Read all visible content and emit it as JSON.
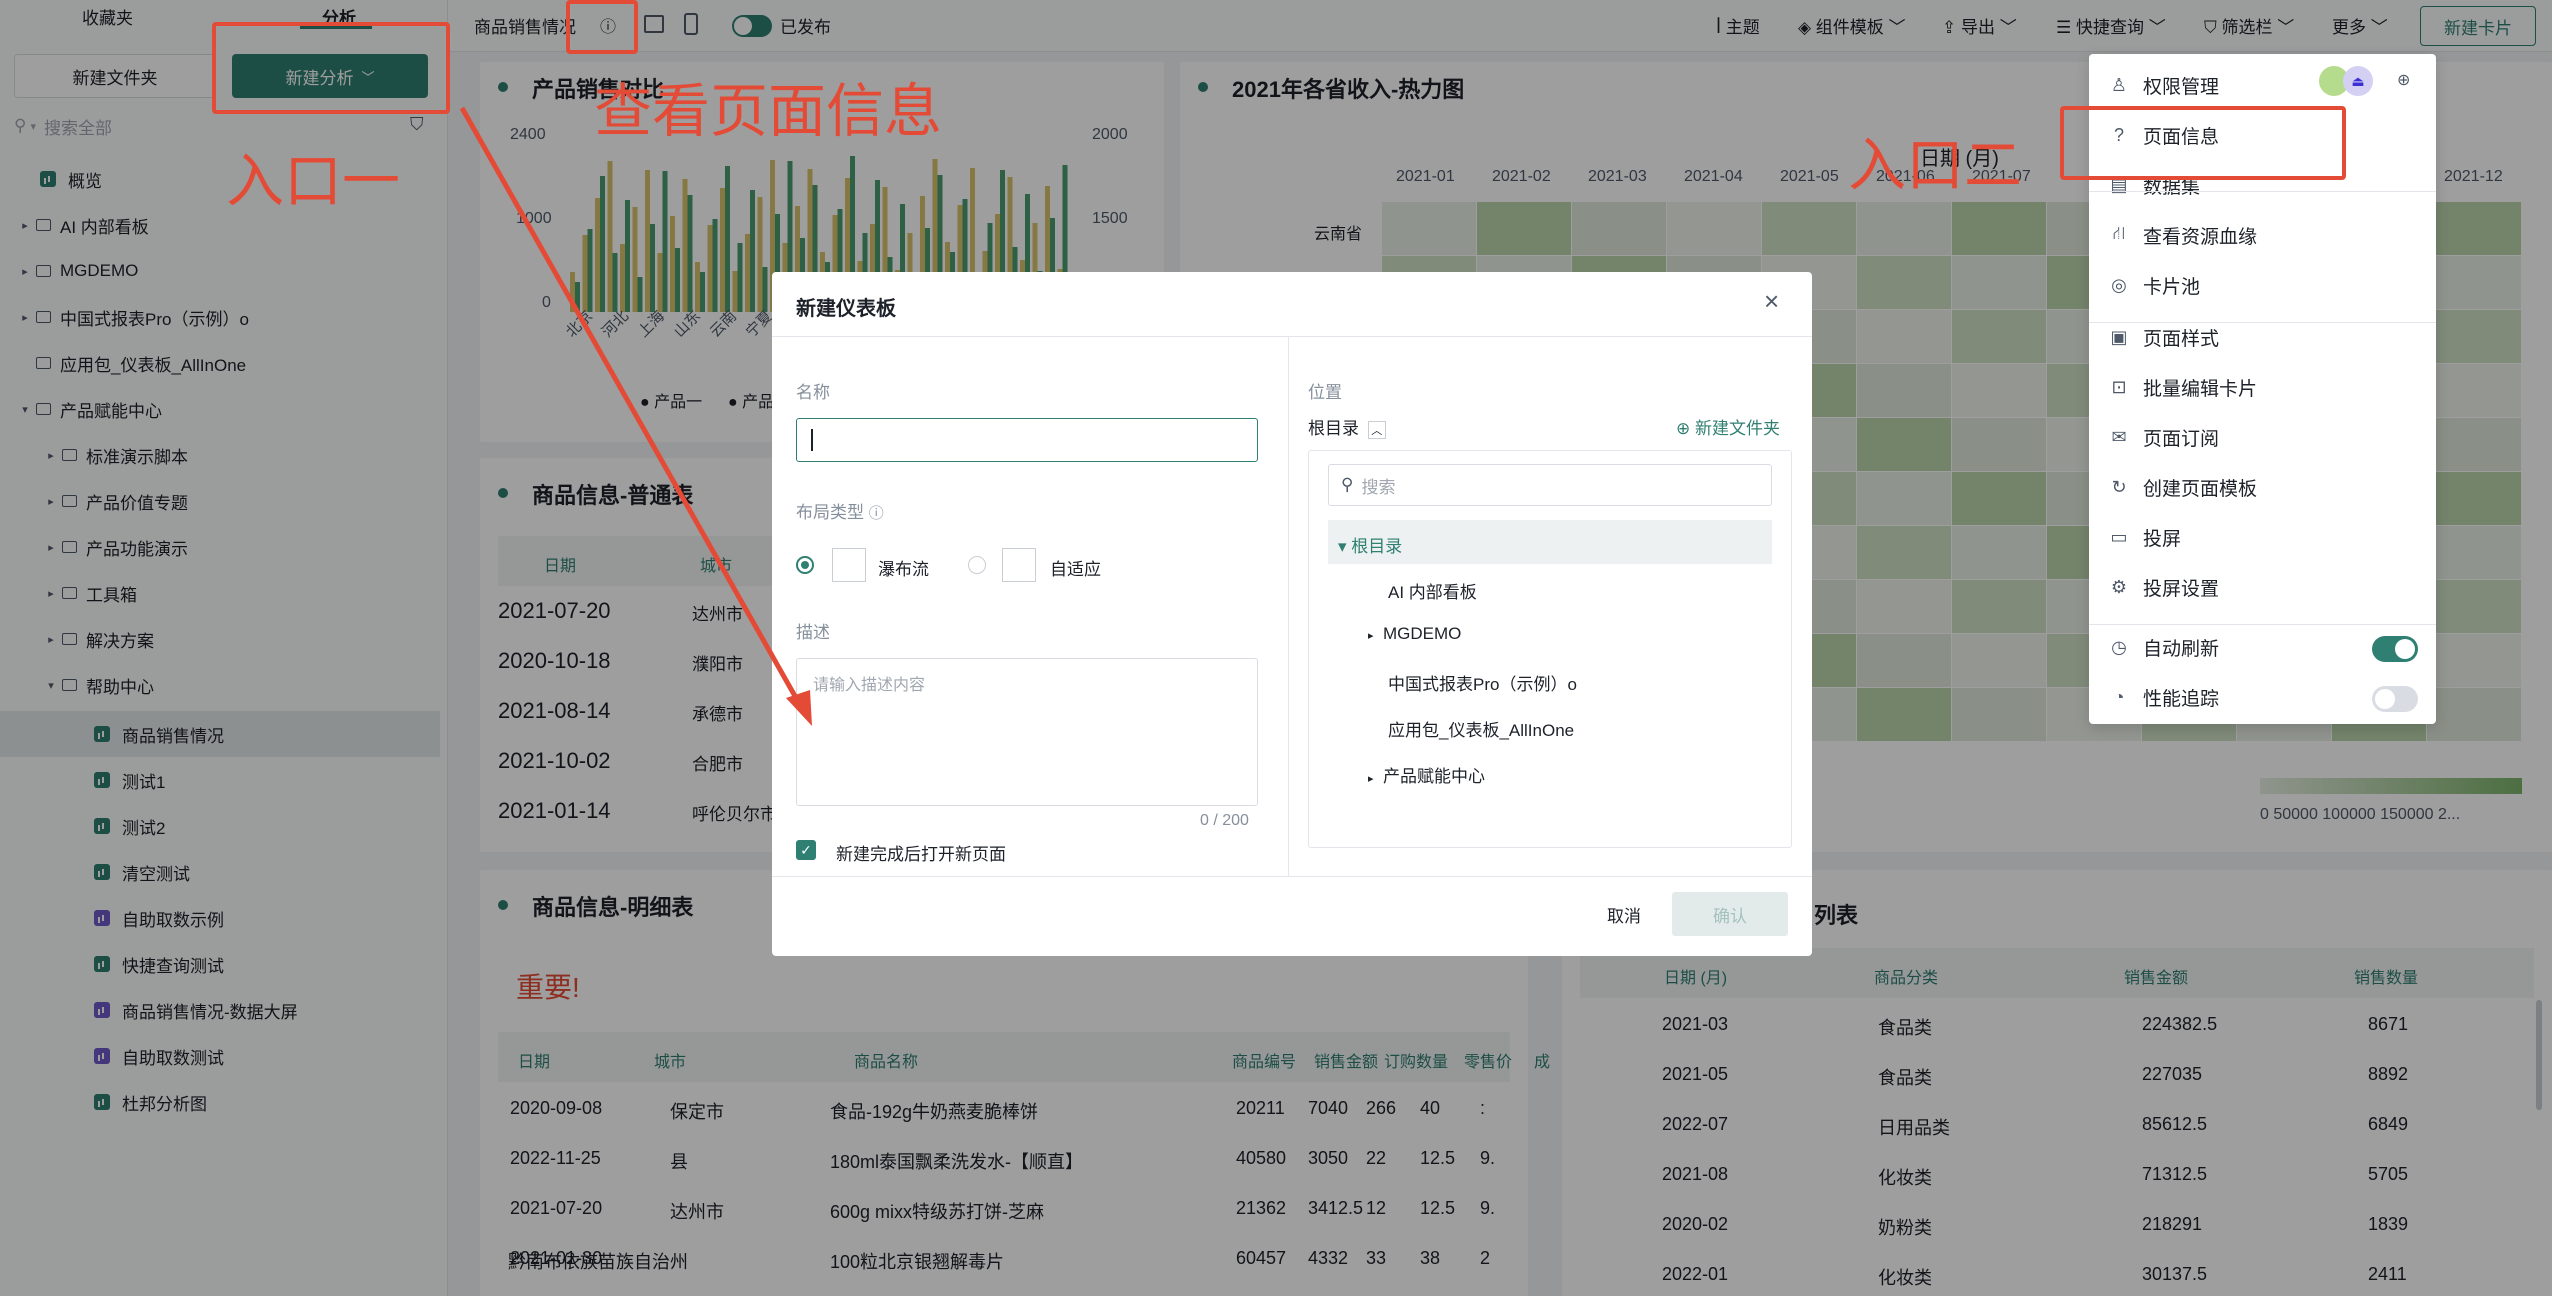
{
  "sidebar": {
    "tab_favorites": "收藏夹",
    "tab_analysis": "分析",
    "new_folder": "新建文件夹",
    "new_analysis": "新建分析",
    "search_placeholder": "搜索全部",
    "items": [
      "概览",
      "AI 内部看板",
      "MGDEMO",
      "中国式报表Pro（示例）o",
      "应用包_仪表板_AllInOne",
      "产品赋能中心",
      "标准演示脚本",
      "产品价值专题",
      "产品功能演示",
      "工具箱",
      "解决方案",
      "帮助中心",
      "商品销售情况",
      "测试1",
      "测试2",
      "清空测试",
      "自助取数示例",
      "快捷查询测试",
      "商品销售情况-数据大屏",
      "自助取数测试",
      "杜邦分析图"
    ]
  },
  "topbar": {
    "page_title": "商品销售情况",
    "published": "已发布",
    "theme": "主题",
    "component_template": "组件模板",
    "export": "导出",
    "quick_query": "快捷查询",
    "filter_bar": "筛选栏",
    "more": "更多",
    "new_card": "新建卡片"
  },
  "card_bar": {
    "title": "产品销售对比",
    "y_left": [
      "2400",
      "1000",
      "0"
    ],
    "y_right": [
      "2000",
      "1500"
    ],
    "x_labels": [
      "北京",
      "河北",
      "上海",
      "山东",
      "云南",
      "宁夏"
    ],
    "legend1": "产品一",
    "legend2": "产品二"
  },
  "card_heat": {
    "title": "2021年各省收入-热力图",
    "axis_title": "日期 (月)",
    "months": [
      "2021-01",
      "2021-02",
      "2021-03",
      "2021-04",
      "2021-05",
      "2021-06",
      "2021-07",
      "2021-12"
    ],
    "row1": "云南省",
    "legend_labels": "0   50000  100000  150000  2..."
  },
  "card_table1": {
    "title": "商品信息-普通表",
    "headers": [
      "日期",
      "城市"
    ],
    "rows": [
      [
        "2021-07-20",
        "达州市"
      ],
      [
        "2020-10-18",
        "濮阳市"
      ],
      [
        "2021-08-14",
        "承德市"
      ],
      [
        "2021-10-02",
        "合肥市"
      ],
      [
        "2021-01-14",
        "呼伦贝尔市"
      ]
    ]
  },
  "card_table2": {
    "title": "商品信息-明细表",
    "important": "重要!",
    "headers": [
      "日期",
      "城市",
      "商品名称",
      "商品编号",
      "销售金额",
      "订购数量",
      "零售价",
      "成"
    ],
    "rows": [
      [
        "2020-09-08",
        "保定市",
        "食品-192g牛奶燕麦脆棒饼",
        "20211",
        "7040",
        "266",
        "40",
        ":"
      ],
      [
        "2022-11-25",
        "县",
        "180ml泰国飘柔洗发水-【顺直】",
        "40580",
        "3050",
        "22",
        "12.5",
        "9."
      ],
      [
        "2021-07-20",
        "达州市",
        "600g mixx特级苏打饼-芝麻",
        "21362",
        "3412.5",
        "12",
        "12.5",
        "9."
      ],
      [
        "2021-01-30",
        "黔南布依族苗族自治州",
        "100粒北京银翘解毒片",
        "60457",
        "4332",
        "33",
        "38",
        "2"
      ]
    ]
  },
  "card_table3": {
    "title": "列表",
    "headers": [
      "日期 (月)",
      "商品分类",
      "销售金额",
      "销售数量"
    ],
    "rows": [
      [
        "2021-03",
        "食品类",
        "224382.5",
        "8671"
      ],
      [
        "2021-05",
        "食品类",
        "227035",
        "8892"
      ],
      [
        "2022-07",
        "日用品类",
        "85612.5",
        "6849"
      ],
      [
        "2021-08",
        "化妆类",
        "71312.5",
        "5705"
      ],
      [
        "2020-02",
        "奶粉类",
        "218291",
        "1839"
      ],
      [
        "2022-01",
        "化妆类",
        "30137.5",
        "2411"
      ]
    ]
  },
  "modal": {
    "title": "新建仪表板",
    "name_label": "名称",
    "layout_label": "布局类型",
    "layout_waterfall": "瀑布流",
    "layout_adaptive": "自适应",
    "desc_label": "描述",
    "desc_placeholder": "请输入描述内容",
    "counter": "0 / 200",
    "open_after": "新建完成后打开新页面",
    "location_label": "位置",
    "root": "根目录",
    "new_folder": "新建文件夹",
    "search_placeholder": "搜索",
    "tree": [
      "根目录",
      "AI 内部看板",
      "MGDEMO",
      "中国式报表Pro（示例）o",
      "应用包_仪表板_AllInOne",
      "产品赋能中心"
    ],
    "cancel": "取消",
    "confirm": "确认"
  },
  "dropdown": {
    "items": [
      "权限管理",
      "页面信息",
      "数据集",
      "查看资源血缘",
      "卡片池",
      "页面样式",
      "批量编辑卡片",
      "页面订阅",
      "创建页面模板",
      "投屏",
      "投屏设置",
      "自动刷新",
      "性能追踪"
    ],
    "auto_refresh": true,
    "perf_trace": false
  },
  "annotations": {
    "entry1": "入口一",
    "entry2": "入口二",
    "view_info": "查看页面信息"
  },
  "colors": {
    "accent": "#2f7f72",
    "annotation": "#e44b36",
    "bar_yellow": "#d9c26b",
    "bar_green": "#4a9b6e"
  }
}
